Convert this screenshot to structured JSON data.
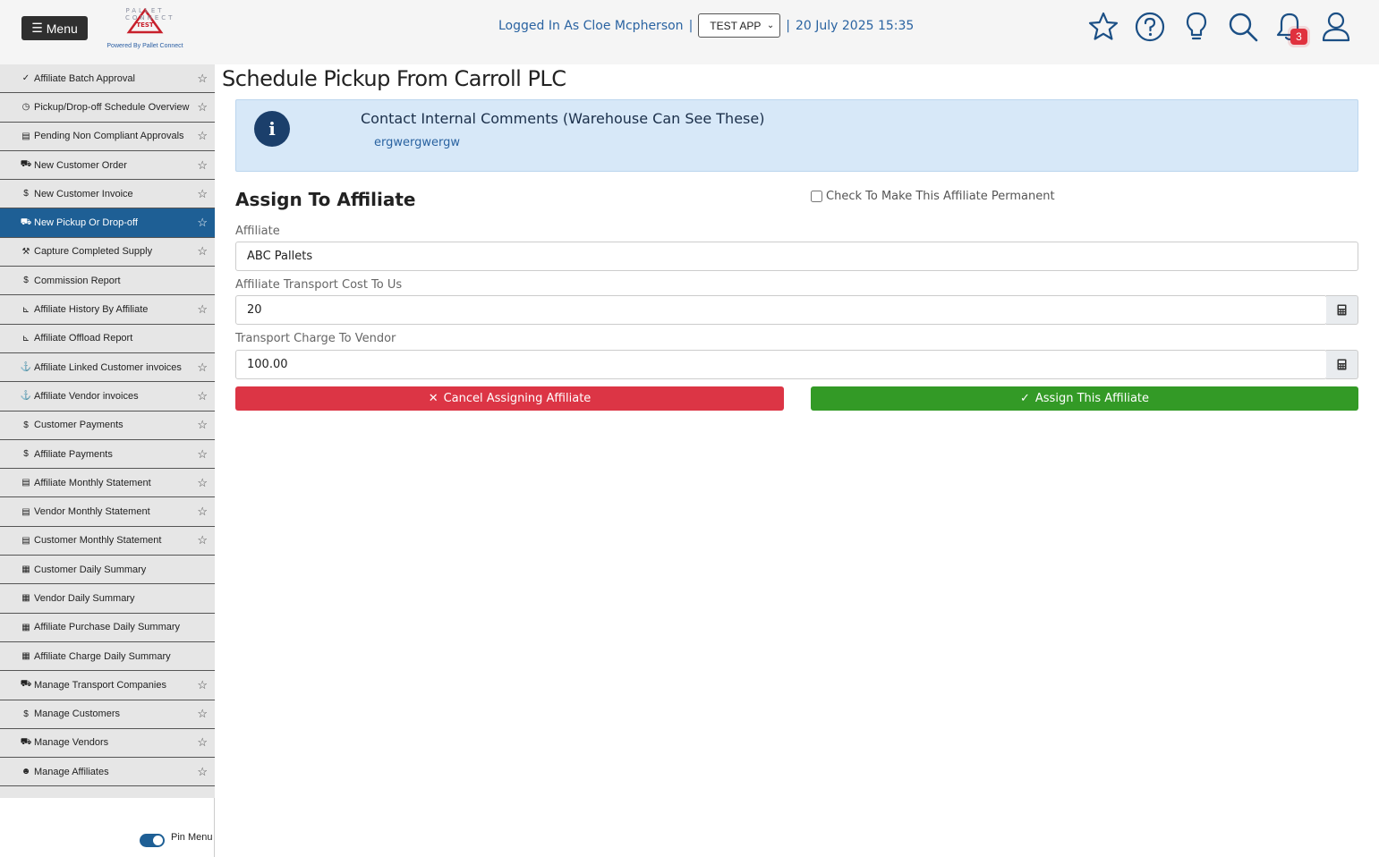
{
  "header": {
    "menu_label": "Menu",
    "logo_top": "PALLET CONNECT",
    "logo_badge": "TEST",
    "logo_sub": "Powered By Pallet Connect",
    "logged_in": "Logged In As Cloe Mcpherson",
    "separator": "|",
    "app_selected": "TEST APP",
    "datetime": "20 July 2025 15:35",
    "notification_count": "3",
    "icons": [
      "star-icon",
      "help-icon",
      "lightbulb-icon",
      "search-icon",
      "bell-icon",
      "user-icon"
    ]
  },
  "sidebar": {
    "items": [
      {
        "label": "Affiliate Batch Approval",
        "icon": "✓",
        "star": true,
        "active": false
      },
      {
        "label": "Pickup/Drop-off Schedule Overview",
        "icon": "◷",
        "star": true,
        "active": false
      },
      {
        "label": "Pending Non Compliant Approvals",
        "icon": "▤",
        "star": true,
        "active": false
      },
      {
        "label": "New Customer Order",
        "icon": "⛟",
        "star": true,
        "active": false
      },
      {
        "label": "New Customer Invoice",
        "icon": "$",
        "star": true,
        "active": false
      },
      {
        "label": "New Pickup Or Drop-off",
        "icon": "⛟",
        "star": true,
        "active": true
      },
      {
        "label": "Capture Completed Supply",
        "icon": "⚒",
        "star": true,
        "active": false
      },
      {
        "label": "Commission Report",
        "icon": "$",
        "star": false,
        "active": false
      },
      {
        "label": "Affiliate History By Affiliate",
        "icon": "⊾",
        "star": true,
        "active": false
      },
      {
        "label": "Affiliate Offload Report",
        "icon": "⊾",
        "star": false,
        "active": false
      },
      {
        "label": "Affiliate Linked Customer invoices",
        "icon": "⚓",
        "star": true,
        "active": false
      },
      {
        "label": "Affiliate Vendor invoices",
        "icon": "⚓",
        "star": true,
        "active": false
      },
      {
        "label": "Customer Payments",
        "icon": "$",
        "star": true,
        "active": false
      },
      {
        "label": "Affiliate Payments",
        "icon": "$",
        "star": true,
        "active": false
      },
      {
        "label": "Affiliate Monthly Statement",
        "icon": "▤",
        "star": true,
        "active": false
      },
      {
        "label": "Vendor Monthly Statement",
        "icon": "▤",
        "star": true,
        "active": false
      },
      {
        "label": "Customer Monthly Statement",
        "icon": "▤",
        "star": true,
        "active": false
      },
      {
        "label": "Customer Daily Summary",
        "icon": "▦",
        "star": false,
        "active": false
      },
      {
        "label": "Vendor Daily Summary",
        "icon": "▦",
        "star": false,
        "active": false
      },
      {
        "label": "Affiliate Purchase Daily Summary",
        "icon": "▦",
        "star": false,
        "active": false
      },
      {
        "label": "Affiliate Charge Daily Summary",
        "icon": "▦",
        "star": false,
        "active": false
      },
      {
        "label": "Manage Transport Companies",
        "icon": "⛟",
        "star": true,
        "active": false
      },
      {
        "label": "Manage Customers",
        "icon": "$",
        "star": true,
        "active": false
      },
      {
        "label": "Manage Vendors",
        "icon": "⛟",
        "star": true,
        "active": false
      },
      {
        "label": "Manage Affiliates",
        "icon": "☻",
        "star": true,
        "active": false
      }
    ],
    "pin_label": "Pin Menu"
  },
  "main": {
    "page_title": "Schedule Pickup From Carroll PLC",
    "info": {
      "title": "Contact Internal Comments (Warehouse Can See These)",
      "comment": "ergwergwergw"
    },
    "section_title": "Assign To Affiliate",
    "permanent_label": "Check To Make This Affiliate Permanent",
    "affiliate_label": "Affiliate",
    "affiliate_value": "ABC Pallets",
    "cost_label": "Affiliate Transport Cost To Us",
    "cost_value": "20",
    "charge_label": "Transport Charge To Vendor",
    "charge_value": "100.00",
    "cancel_label": "Cancel Assigning Affiliate",
    "assign_label": "Assign This Affiliate"
  },
  "colors": {
    "primary": "#1e5f95",
    "danger": "#dc3545",
    "success": "#339a26",
    "info_bg": "#d7e8f8"
  }
}
